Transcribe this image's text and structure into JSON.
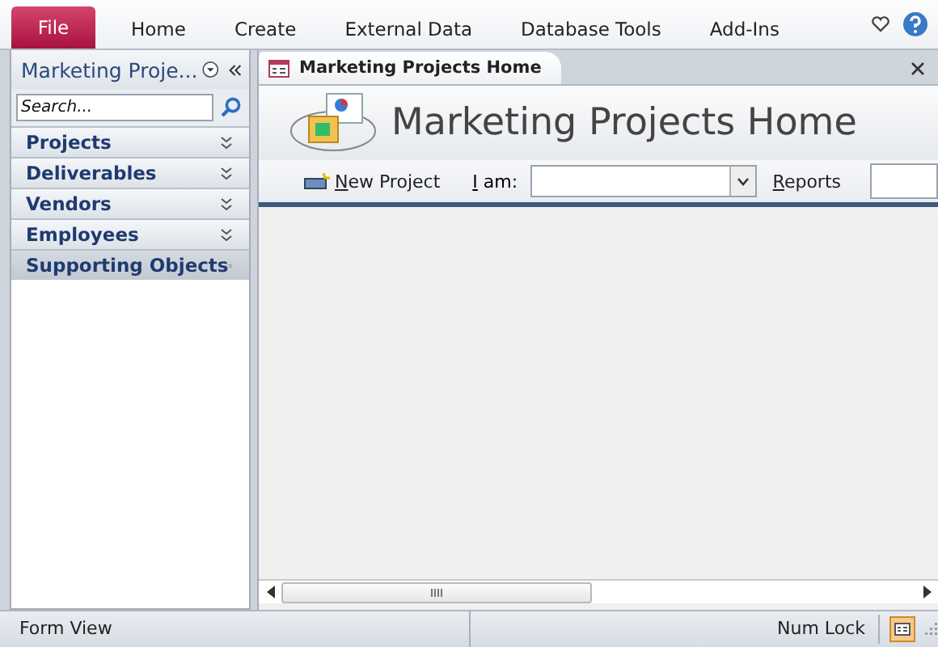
{
  "ribbon": {
    "tabs": [
      {
        "label": "File",
        "selected": true
      },
      {
        "label": "Home",
        "selected": false
      },
      {
        "label": "Create",
        "selected": false
      },
      {
        "label": "External Data",
        "selected": false
      },
      {
        "label": "Database Tools",
        "selected": false
      },
      {
        "label": "Add-Ins",
        "selected": false
      }
    ]
  },
  "navigation_pane": {
    "title": "Marketing Proje...",
    "search": {
      "placeholder": "Search..."
    },
    "groups": [
      {
        "label": "Projects",
        "selected": false
      },
      {
        "label": "Deliverables",
        "selected": false
      },
      {
        "label": "Vendors",
        "selected": false
      },
      {
        "label": "Employees",
        "selected": false
      },
      {
        "label": "Supporting Objects",
        "selected": true
      }
    ]
  },
  "document": {
    "tab": {
      "label": "Marketing Projects Home"
    },
    "heading": "Marketing Projects Home",
    "toolbar": {
      "new_button": "New Project",
      "user_label": "I am:",
      "reports_label": "Reports"
    }
  },
  "status_bar": {
    "view": "Form View",
    "indicator": "Num Lock"
  }
}
